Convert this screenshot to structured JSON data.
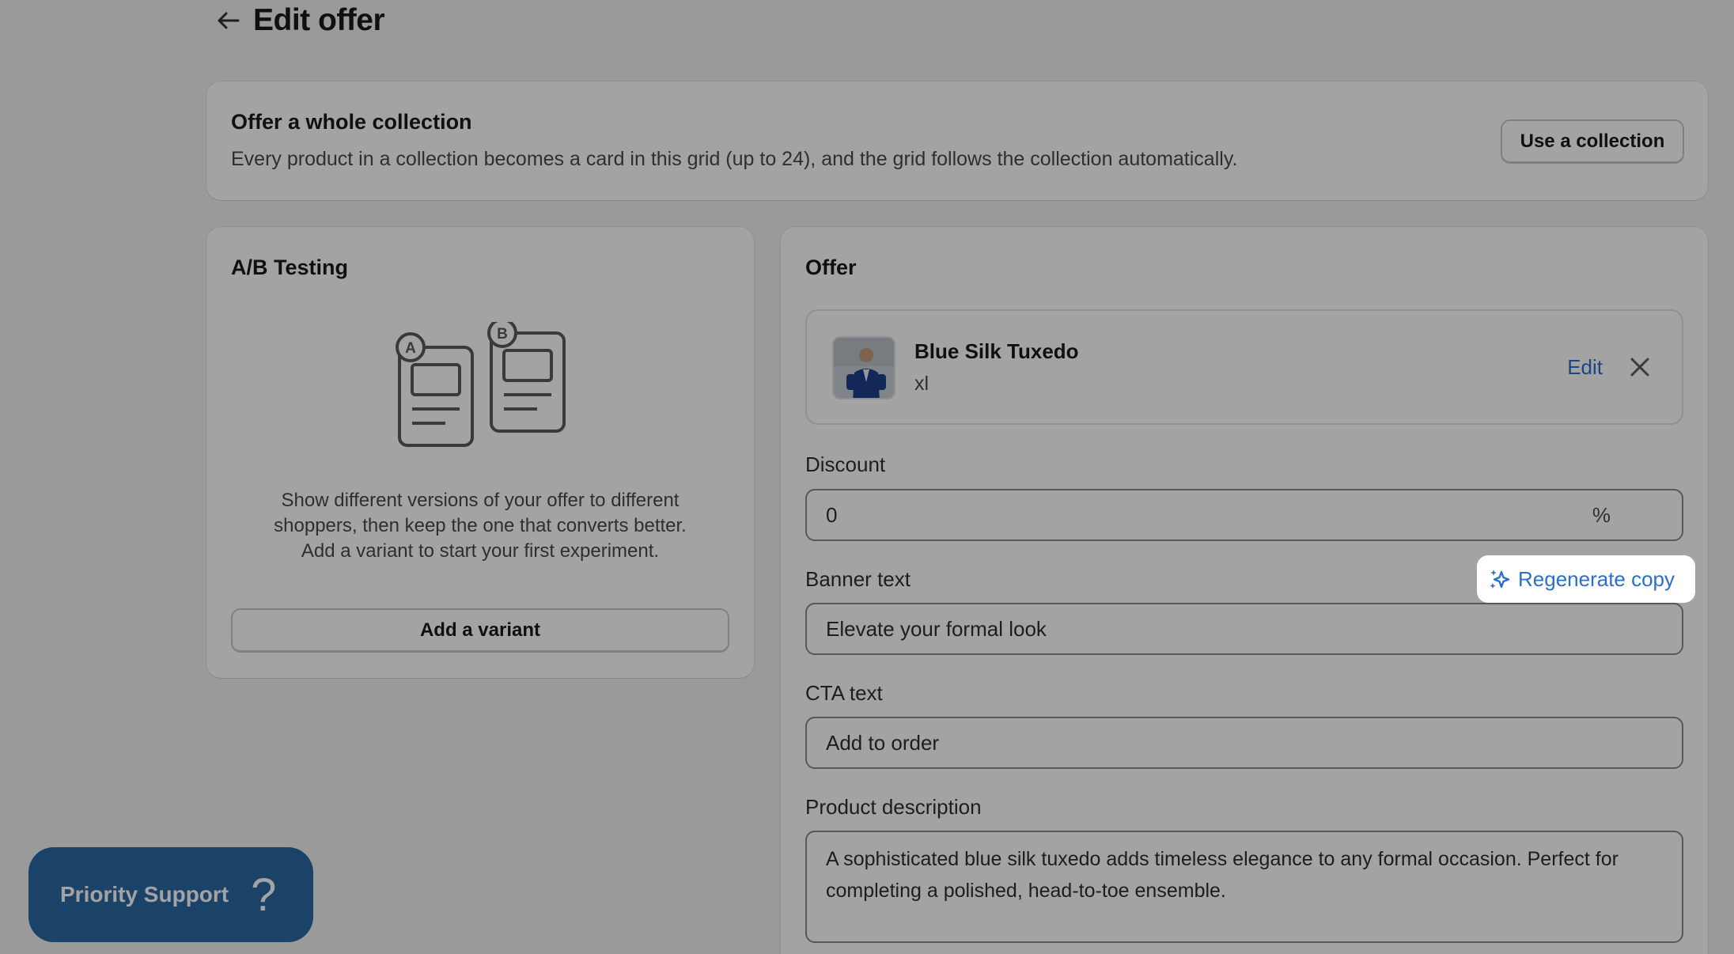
{
  "header": {
    "title": "Edit offer"
  },
  "collection": {
    "title": "Offer a whole collection",
    "description": "Every product in a collection becomes a card in this grid (up to 24), and the grid follows the collection automatically.",
    "button_label": "Use a collection"
  },
  "ab_testing": {
    "title": "A/B Testing",
    "badge_a": "A",
    "badge_b": "B",
    "description_lines": [
      "Show different versions of your offer to different",
      "shoppers, then keep the one that converts better.",
      "Add a variant to start your first experiment."
    ],
    "button_label": "Add a variant"
  },
  "offer": {
    "title": "Offer",
    "product": {
      "name": "Blue Silk Tuxedo",
      "variant": "xl",
      "edit_label": "Edit"
    },
    "discount": {
      "label": "Discount",
      "value": "0",
      "suffix": "%"
    },
    "banner": {
      "label": "Banner text",
      "value": "Elevate your formal look",
      "regenerate_label": "Regenerate copy"
    },
    "cta": {
      "label": "CTA text",
      "value": "Add to order"
    },
    "description": {
      "label": "Product description",
      "value": "A sophisticated blue silk tuxedo adds timeless elegance to any formal occasion. Perfect for completing a polished, head-to-toe ensemble."
    }
  },
  "support": {
    "label": "Priority Support",
    "icon": "question-mark-icon"
  },
  "colors": {
    "link": "#2c6ecb",
    "support": "#2b6aa3",
    "overlay": "rgba(0,0,0,0.36)"
  }
}
